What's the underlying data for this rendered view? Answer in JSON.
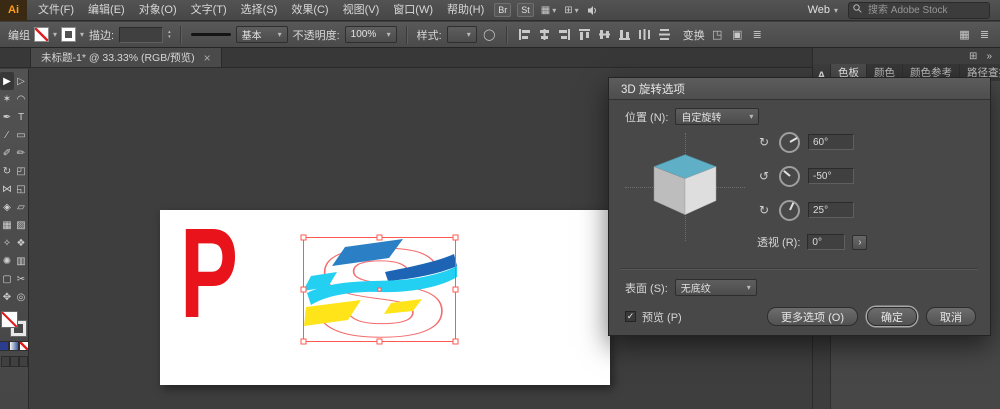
{
  "glyphs": {
    "caret_down": "▾",
    "caret_up": "▴",
    "close": "×",
    "collapse": "»",
    "menu": "≣",
    "grid": "▦",
    "layout": "⊞",
    "circle": "◯",
    "chevron_right": "›",
    "check": "✓"
  },
  "menubar": {
    "logo": "Ai",
    "items": [
      {
        "label": "文件(F)"
      },
      {
        "label": "编辑(E)"
      },
      {
        "label": "对象(O)"
      },
      {
        "label": "文字(T)"
      },
      {
        "label": "选择(S)"
      },
      {
        "label": "效果(C)"
      },
      {
        "label": "视图(V)"
      },
      {
        "label": "窗口(W)"
      },
      {
        "label": "帮助(H)"
      }
    ],
    "bridge_label": "Br",
    "stock_label": "St",
    "workspace_value": "Web",
    "search_placeholder": "搜索 Adobe Stock"
  },
  "controlbar": {
    "selection_type": "编组",
    "stroke_label": "描边:",
    "brush_name": "基本",
    "opacity_label": "不透明度:",
    "opacity_value": "100%",
    "style_label": "样式:",
    "transform_label": "变换"
  },
  "tabbar": {
    "document_title": "未标题-1* @ 33.33% (RGB/预览)"
  },
  "toolbar": {
    "tools": [
      {
        "name": "selection-tool",
        "glyph": "▶"
      },
      {
        "name": "direct-selection-tool",
        "glyph": "▷"
      },
      {
        "name": "magic-wand-tool",
        "glyph": "✶"
      },
      {
        "name": "lasso-tool",
        "glyph": "◠"
      },
      {
        "name": "pen-tool",
        "glyph": "✒"
      },
      {
        "name": "type-tool",
        "glyph": "T"
      },
      {
        "name": "line-segment-tool",
        "glyph": "∕"
      },
      {
        "name": "rectangle-tool",
        "glyph": "▭"
      },
      {
        "name": "paintbrush-tool",
        "glyph": "✐"
      },
      {
        "name": "pencil-tool",
        "glyph": "✏"
      },
      {
        "name": "rotate-tool",
        "glyph": "↻"
      },
      {
        "name": "scale-tool",
        "glyph": "◰"
      },
      {
        "name": "width-tool",
        "glyph": "⋈"
      },
      {
        "name": "free-transform-tool",
        "glyph": "◱"
      },
      {
        "name": "shape-builder-tool",
        "glyph": "◈"
      },
      {
        "name": "perspective-grid-tool",
        "glyph": "▱"
      },
      {
        "name": "mesh-tool",
        "glyph": "▦"
      },
      {
        "name": "gradient-tool",
        "glyph": "▨"
      },
      {
        "name": "eyedropper-tool",
        "glyph": "✧"
      },
      {
        "name": "blend-tool",
        "glyph": "❖"
      },
      {
        "name": "symbol-sprayer-tool",
        "glyph": "✺"
      },
      {
        "name": "column-graph-tool",
        "glyph": "▥"
      },
      {
        "name": "artboard-tool",
        "glyph": "▢"
      },
      {
        "name": "slice-tool",
        "glyph": "✂"
      },
      {
        "name": "hand-tool",
        "glyph": "✥"
      },
      {
        "name": "zoom-tool",
        "glyph": "◎"
      }
    ]
  },
  "canvas": {
    "letter": "P",
    "letter_color": "#e8131b",
    "logo_letter": "S",
    "outline_color": "#f36d6d",
    "selection_color": "#ff5a52",
    "logo_colors": {
      "blue": "#2b7fc4",
      "dark_blue": "#1d64b5",
      "cyan": "#23d0f2",
      "yellow": "#ffe41a"
    }
  },
  "dialog": {
    "title": "3D 旋转选项",
    "position_label": "位置 (N):",
    "position_value": "自定旋转",
    "cube_top_color": "#5fb0c6",
    "rotation_rows": [
      {
        "icon": "↻",
        "value": "60°"
      },
      {
        "icon": "↺",
        "value": "-50°"
      },
      {
        "icon": "↻",
        "value": "25°"
      }
    ],
    "perspective_label": "透视 (R):",
    "perspective_value": "0°",
    "surface_label": "表面 (S):",
    "surface_value": "无底纹",
    "preview_label": "预览 (P)",
    "more_options_label": "更多选项 (O)",
    "ok_label": "确定",
    "cancel_label": "取消"
  },
  "rightdock": {
    "collapsed_icon": "A",
    "tabs": [
      {
        "label": "色板"
      },
      {
        "label": "颜色"
      },
      {
        "label": "颜色参考"
      },
      {
        "label": "路径查找"
      }
    ]
  }
}
